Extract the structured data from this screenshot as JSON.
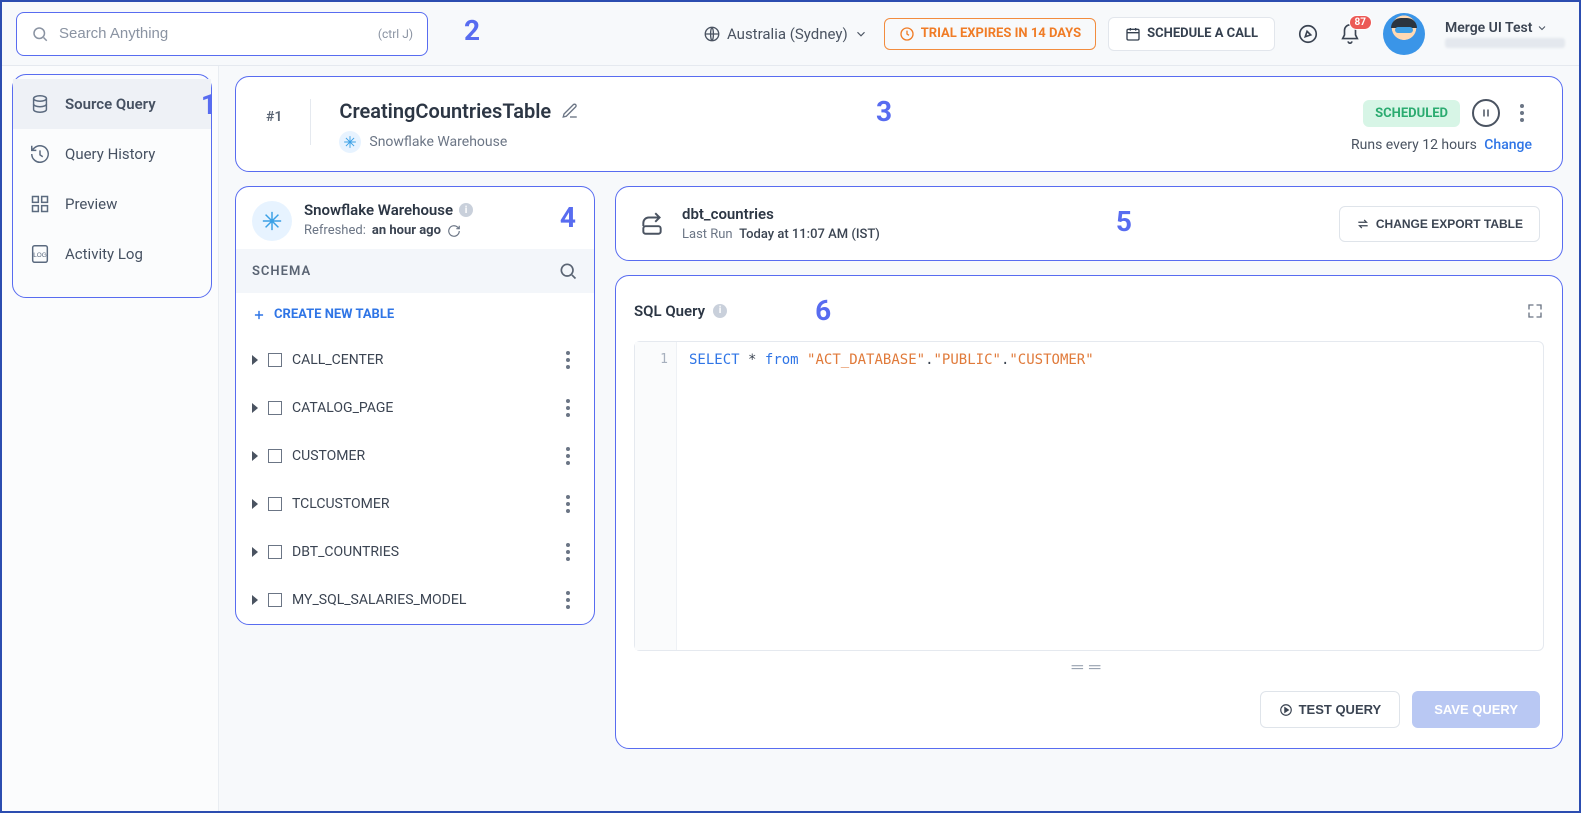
{
  "topbar": {
    "search_placeholder": "Search Anything",
    "search_hint": "(ctrl J)",
    "region": "Australia (Sydney)",
    "trial": "TRIAL EXPIRES IN 14 DAYS",
    "schedule_call": "SCHEDULE A CALL",
    "bell_count": "87",
    "user_name": "Merge UI Test"
  },
  "callouts": {
    "c1": "1",
    "c2": "2",
    "c3": "3",
    "c4": "4",
    "c5": "5",
    "c6": "6"
  },
  "sidebar": {
    "items": [
      {
        "label": "Source Query",
        "icon": "db"
      },
      {
        "label": "Query History",
        "icon": "history"
      },
      {
        "label": "Preview",
        "icon": "grid"
      },
      {
        "label": "Activity Log",
        "icon": "log"
      }
    ]
  },
  "header": {
    "task_num": "#1",
    "title": "CreatingCountriesTable",
    "source": "Snowflake Warehouse",
    "status": "SCHEDULED",
    "schedule_line": "Runs every 12 hours",
    "change": "Change"
  },
  "schema": {
    "title": "Snowflake Warehouse",
    "refreshed_label": "Refreshed:",
    "refreshed_value": "an hour ago",
    "section": "SCHEMA",
    "create": "CREATE NEW TABLE",
    "tables": [
      "CALL_CENTER",
      "CATALOG_PAGE",
      "CUSTOMER",
      "TCLCUSTOMER",
      "DBT_COUNTRIES",
      "MY_SQL_SALARIES_MODEL"
    ]
  },
  "export": {
    "table": "dbt_countries",
    "last_run_label": "Last Run",
    "last_run_value": "Today at 11:07 AM (IST)",
    "change_btn": "CHANGE EXPORT TABLE"
  },
  "sql": {
    "label": "SQL Query",
    "line_no": "1",
    "tokens": {
      "kw1": "SELECT",
      "star": "*",
      "kw2": "from",
      "s1": "\"ACT_DATABASE\"",
      "dot1": ".",
      "s2": "\"PUBLIC\"",
      "dot2": ".",
      "s3": "\"CUSTOMER\""
    },
    "test_btn": "TEST QUERY",
    "save_btn": "SAVE QUERY"
  }
}
